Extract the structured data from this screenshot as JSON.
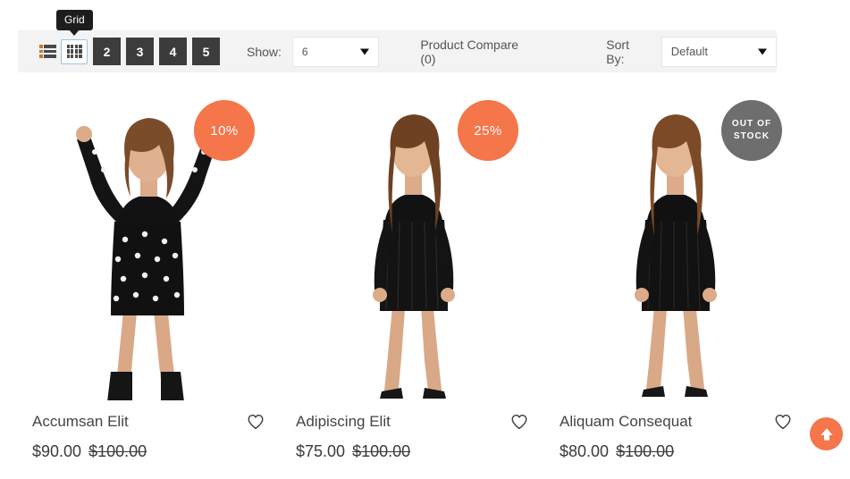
{
  "toolbar": {
    "tooltip_label": "Grid",
    "view_list_icon": "list-view-icon",
    "view_grid_icon": "grid-view-icon",
    "page_buttons": [
      "2",
      "3",
      "4",
      "5"
    ],
    "show_label": "Show:",
    "show_value": "6",
    "compare_label": "Product Compare (0)",
    "sort_label": "Sort By:",
    "sort_value": "Default"
  },
  "products": [
    {
      "name": "Accumsan Elit",
      "badge_text": "10%",
      "badge_type": "sale",
      "price": "$90.00",
      "old_price": "$100.00",
      "wishlist_icon": "heart-icon"
    },
    {
      "name": "Adipiscing Elit",
      "badge_text": "25%",
      "badge_type": "sale",
      "price": "$75.00",
      "old_price": "$100.00",
      "wishlist_icon": "heart-icon"
    },
    {
      "name": "Aliquam Consequat",
      "badge_text": "OUT OF STOCK",
      "badge_type": "out-of-stock",
      "price": "$80.00",
      "old_price": "$100.00",
      "wishlist_icon": "heart-icon"
    }
  ],
  "scroll_top": {
    "icon": "arrow-up-icon"
  },
  "colors": {
    "accent_orange": "#f4764a",
    "out_of_stock_gray": "#6e6e6e",
    "toolbar_bg": "#f3f3f3",
    "page_button_bg": "#3c3c3c",
    "tooltip_bg": "#1d1d1d"
  }
}
